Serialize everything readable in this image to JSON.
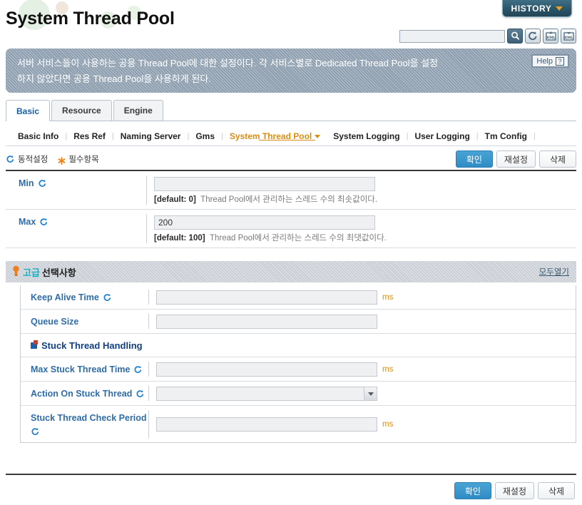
{
  "header": {
    "title": "System Thread Pool",
    "history_label": "HISTORY",
    "history_caret_icon": "chevron-down-icon",
    "search_value": "",
    "search_placeholder": "",
    "tools": [
      {
        "name": "search-icon",
        "title": "Search"
      },
      {
        "name": "refresh-icon",
        "title": "Refresh"
      },
      {
        "name": "xml-export-icon",
        "title": "Export XML"
      },
      {
        "name": "xml-import-icon",
        "title": "Import XML"
      }
    ]
  },
  "banner": {
    "line1": "서버 서비스들이 사용하는 공용 Thread Pool에 대한 설정이다. 각 서비스별로 Dedicated Thread Pool을 설정",
    "line2": "하지 않았다면 공용 Thread Pool을 사용하게 된다.",
    "help_label": "Help",
    "help_icon": "question-mark-icon"
  },
  "tabs": [
    {
      "label": "Basic",
      "active": true
    },
    {
      "label": "Resource",
      "active": false
    },
    {
      "label": "Engine",
      "active": false
    }
  ],
  "subnav": [
    {
      "label": "Basic Info",
      "active": false
    },
    {
      "label": "Res Ref",
      "active": false
    },
    {
      "label": "Naming Server",
      "active": false
    },
    {
      "label": "Gms",
      "active": false
    },
    {
      "label": "System Thread Pool",
      "active": true
    },
    {
      "label": "System Logging",
      "active": false
    },
    {
      "label": "User Logging",
      "active": false
    },
    {
      "label": "Tm Config",
      "active": false
    }
  ],
  "actionbar": {
    "legend_dynamic": "동적설정",
    "legend_required": "필수항목",
    "confirm_label": "확인",
    "reset_label": "재설정",
    "delete_label": "삭제"
  },
  "basic_fields": [
    {
      "label": "Min",
      "dynamic": true,
      "value": "",
      "default_label": "[default: 0]",
      "hint": "Thread Pool에서 관리하는 스레드 수의 최솟값이다."
    },
    {
      "label": "Max",
      "dynamic": true,
      "value": "200",
      "default_label": "[default: 100]",
      "hint": "Thread Pool에서 관리하는 스레드 수의 최댓값이다."
    }
  ],
  "advanced": {
    "title_ko": "고급",
    "title_rest": "선택사항",
    "bulb_icon": "lightbulb-icon",
    "expand_all_label": "모두열기",
    "fields": [
      {
        "label": "Keep Alive Time",
        "dynamic": true,
        "value": "",
        "unit": "ms",
        "type": "text"
      },
      {
        "label": "Queue Size",
        "dynamic": false,
        "value": "",
        "unit": "",
        "type": "text"
      }
    ],
    "subsection": {
      "title": "Stuck Thread Handling",
      "fields": [
        {
          "label": "Max Stuck Thread Time",
          "dynamic": true,
          "value": "",
          "unit": "ms",
          "type": "text"
        },
        {
          "label": "Action On Stuck Thread",
          "dynamic": true,
          "value": "",
          "unit": "",
          "type": "select"
        },
        {
          "label": "Stuck Thread Check Period",
          "dynamic": true,
          "value": "",
          "unit": "ms",
          "type": "text"
        }
      ]
    }
  },
  "footer": {
    "confirm_label": "확인",
    "reset_label": "재설정",
    "delete_label": "삭제"
  }
}
